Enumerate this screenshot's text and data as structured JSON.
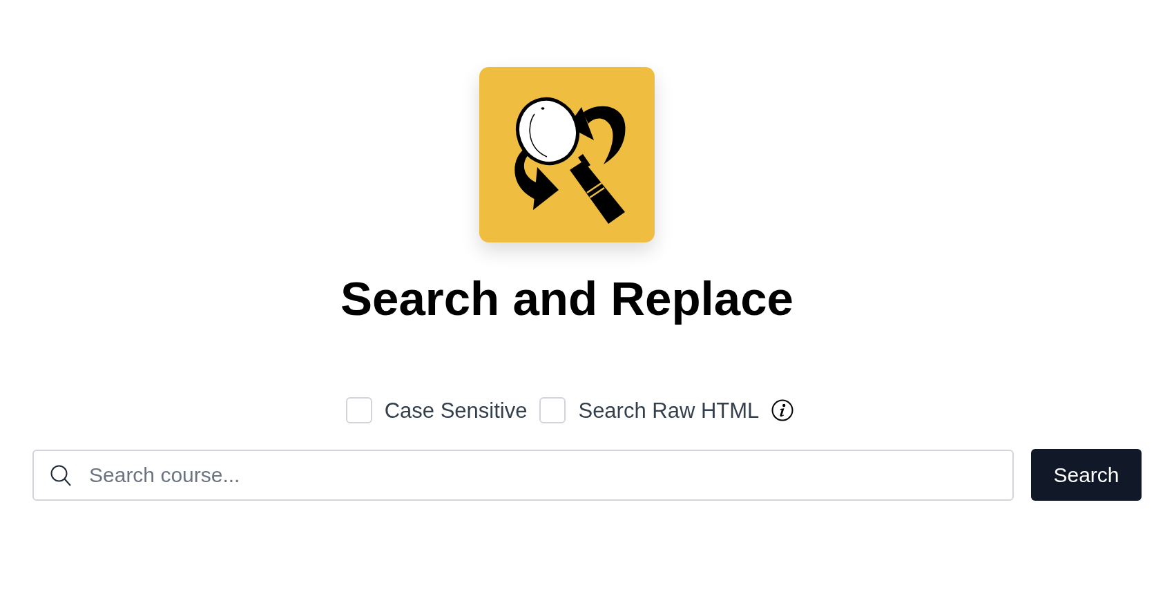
{
  "title": "Search and Replace",
  "options": [
    {
      "label": "Case Sensitive",
      "checked": false,
      "info": false
    },
    {
      "label": "Search Raw HTML",
      "checked": false,
      "info": true
    }
  ],
  "search": {
    "placeholder": "Search course...",
    "button": "Search"
  }
}
